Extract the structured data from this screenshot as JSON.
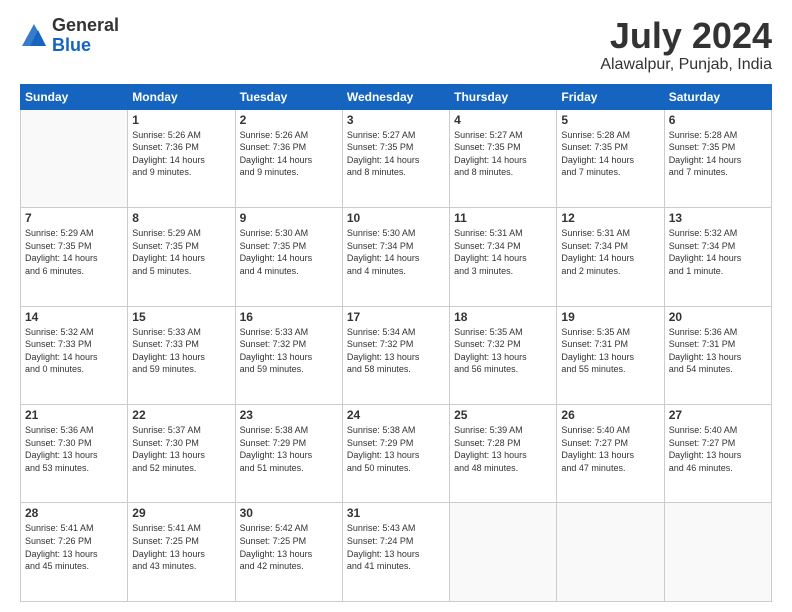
{
  "header": {
    "logo_general": "General",
    "logo_blue": "Blue",
    "month_title": "July 2024",
    "location": "Alawalpur, Punjab, India"
  },
  "weekdays": [
    "Sunday",
    "Monday",
    "Tuesday",
    "Wednesday",
    "Thursday",
    "Friday",
    "Saturday"
  ],
  "weeks": [
    [
      {
        "day": "",
        "info": ""
      },
      {
        "day": "1",
        "info": "Sunrise: 5:26 AM\nSunset: 7:36 PM\nDaylight: 14 hours\nand 9 minutes."
      },
      {
        "day": "2",
        "info": "Sunrise: 5:26 AM\nSunset: 7:36 PM\nDaylight: 14 hours\nand 9 minutes."
      },
      {
        "day": "3",
        "info": "Sunrise: 5:27 AM\nSunset: 7:35 PM\nDaylight: 14 hours\nand 8 minutes."
      },
      {
        "day": "4",
        "info": "Sunrise: 5:27 AM\nSunset: 7:35 PM\nDaylight: 14 hours\nand 8 minutes."
      },
      {
        "day": "5",
        "info": "Sunrise: 5:28 AM\nSunset: 7:35 PM\nDaylight: 14 hours\nand 7 minutes."
      },
      {
        "day": "6",
        "info": "Sunrise: 5:28 AM\nSunset: 7:35 PM\nDaylight: 14 hours\nand 7 minutes."
      }
    ],
    [
      {
        "day": "7",
        "info": "Sunrise: 5:29 AM\nSunset: 7:35 PM\nDaylight: 14 hours\nand 6 minutes."
      },
      {
        "day": "8",
        "info": "Sunrise: 5:29 AM\nSunset: 7:35 PM\nDaylight: 14 hours\nand 5 minutes."
      },
      {
        "day": "9",
        "info": "Sunrise: 5:30 AM\nSunset: 7:35 PM\nDaylight: 14 hours\nand 4 minutes."
      },
      {
        "day": "10",
        "info": "Sunrise: 5:30 AM\nSunset: 7:34 PM\nDaylight: 14 hours\nand 4 minutes."
      },
      {
        "day": "11",
        "info": "Sunrise: 5:31 AM\nSunset: 7:34 PM\nDaylight: 14 hours\nand 3 minutes."
      },
      {
        "day": "12",
        "info": "Sunrise: 5:31 AM\nSunset: 7:34 PM\nDaylight: 14 hours\nand 2 minutes."
      },
      {
        "day": "13",
        "info": "Sunrise: 5:32 AM\nSunset: 7:34 PM\nDaylight: 14 hours\nand 1 minute."
      }
    ],
    [
      {
        "day": "14",
        "info": "Sunrise: 5:32 AM\nSunset: 7:33 PM\nDaylight: 14 hours\nand 0 minutes."
      },
      {
        "day": "15",
        "info": "Sunrise: 5:33 AM\nSunset: 7:33 PM\nDaylight: 13 hours\nand 59 minutes."
      },
      {
        "day": "16",
        "info": "Sunrise: 5:33 AM\nSunset: 7:32 PM\nDaylight: 13 hours\nand 59 minutes."
      },
      {
        "day": "17",
        "info": "Sunrise: 5:34 AM\nSunset: 7:32 PM\nDaylight: 13 hours\nand 58 minutes."
      },
      {
        "day": "18",
        "info": "Sunrise: 5:35 AM\nSunset: 7:32 PM\nDaylight: 13 hours\nand 56 minutes."
      },
      {
        "day": "19",
        "info": "Sunrise: 5:35 AM\nSunset: 7:31 PM\nDaylight: 13 hours\nand 55 minutes."
      },
      {
        "day": "20",
        "info": "Sunrise: 5:36 AM\nSunset: 7:31 PM\nDaylight: 13 hours\nand 54 minutes."
      }
    ],
    [
      {
        "day": "21",
        "info": "Sunrise: 5:36 AM\nSunset: 7:30 PM\nDaylight: 13 hours\nand 53 minutes."
      },
      {
        "day": "22",
        "info": "Sunrise: 5:37 AM\nSunset: 7:30 PM\nDaylight: 13 hours\nand 52 minutes."
      },
      {
        "day": "23",
        "info": "Sunrise: 5:38 AM\nSunset: 7:29 PM\nDaylight: 13 hours\nand 51 minutes."
      },
      {
        "day": "24",
        "info": "Sunrise: 5:38 AM\nSunset: 7:29 PM\nDaylight: 13 hours\nand 50 minutes."
      },
      {
        "day": "25",
        "info": "Sunrise: 5:39 AM\nSunset: 7:28 PM\nDaylight: 13 hours\nand 48 minutes."
      },
      {
        "day": "26",
        "info": "Sunrise: 5:40 AM\nSunset: 7:27 PM\nDaylight: 13 hours\nand 47 minutes."
      },
      {
        "day": "27",
        "info": "Sunrise: 5:40 AM\nSunset: 7:27 PM\nDaylight: 13 hours\nand 46 minutes."
      }
    ],
    [
      {
        "day": "28",
        "info": "Sunrise: 5:41 AM\nSunset: 7:26 PM\nDaylight: 13 hours\nand 45 minutes."
      },
      {
        "day": "29",
        "info": "Sunrise: 5:41 AM\nSunset: 7:25 PM\nDaylight: 13 hours\nand 43 minutes."
      },
      {
        "day": "30",
        "info": "Sunrise: 5:42 AM\nSunset: 7:25 PM\nDaylight: 13 hours\nand 42 minutes."
      },
      {
        "day": "31",
        "info": "Sunrise: 5:43 AM\nSunset: 7:24 PM\nDaylight: 13 hours\nand 41 minutes."
      },
      {
        "day": "",
        "info": ""
      },
      {
        "day": "",
        "info": ""
      },
      {
        "day": "",
        "info": ""
      }
    ]
  ]
}
